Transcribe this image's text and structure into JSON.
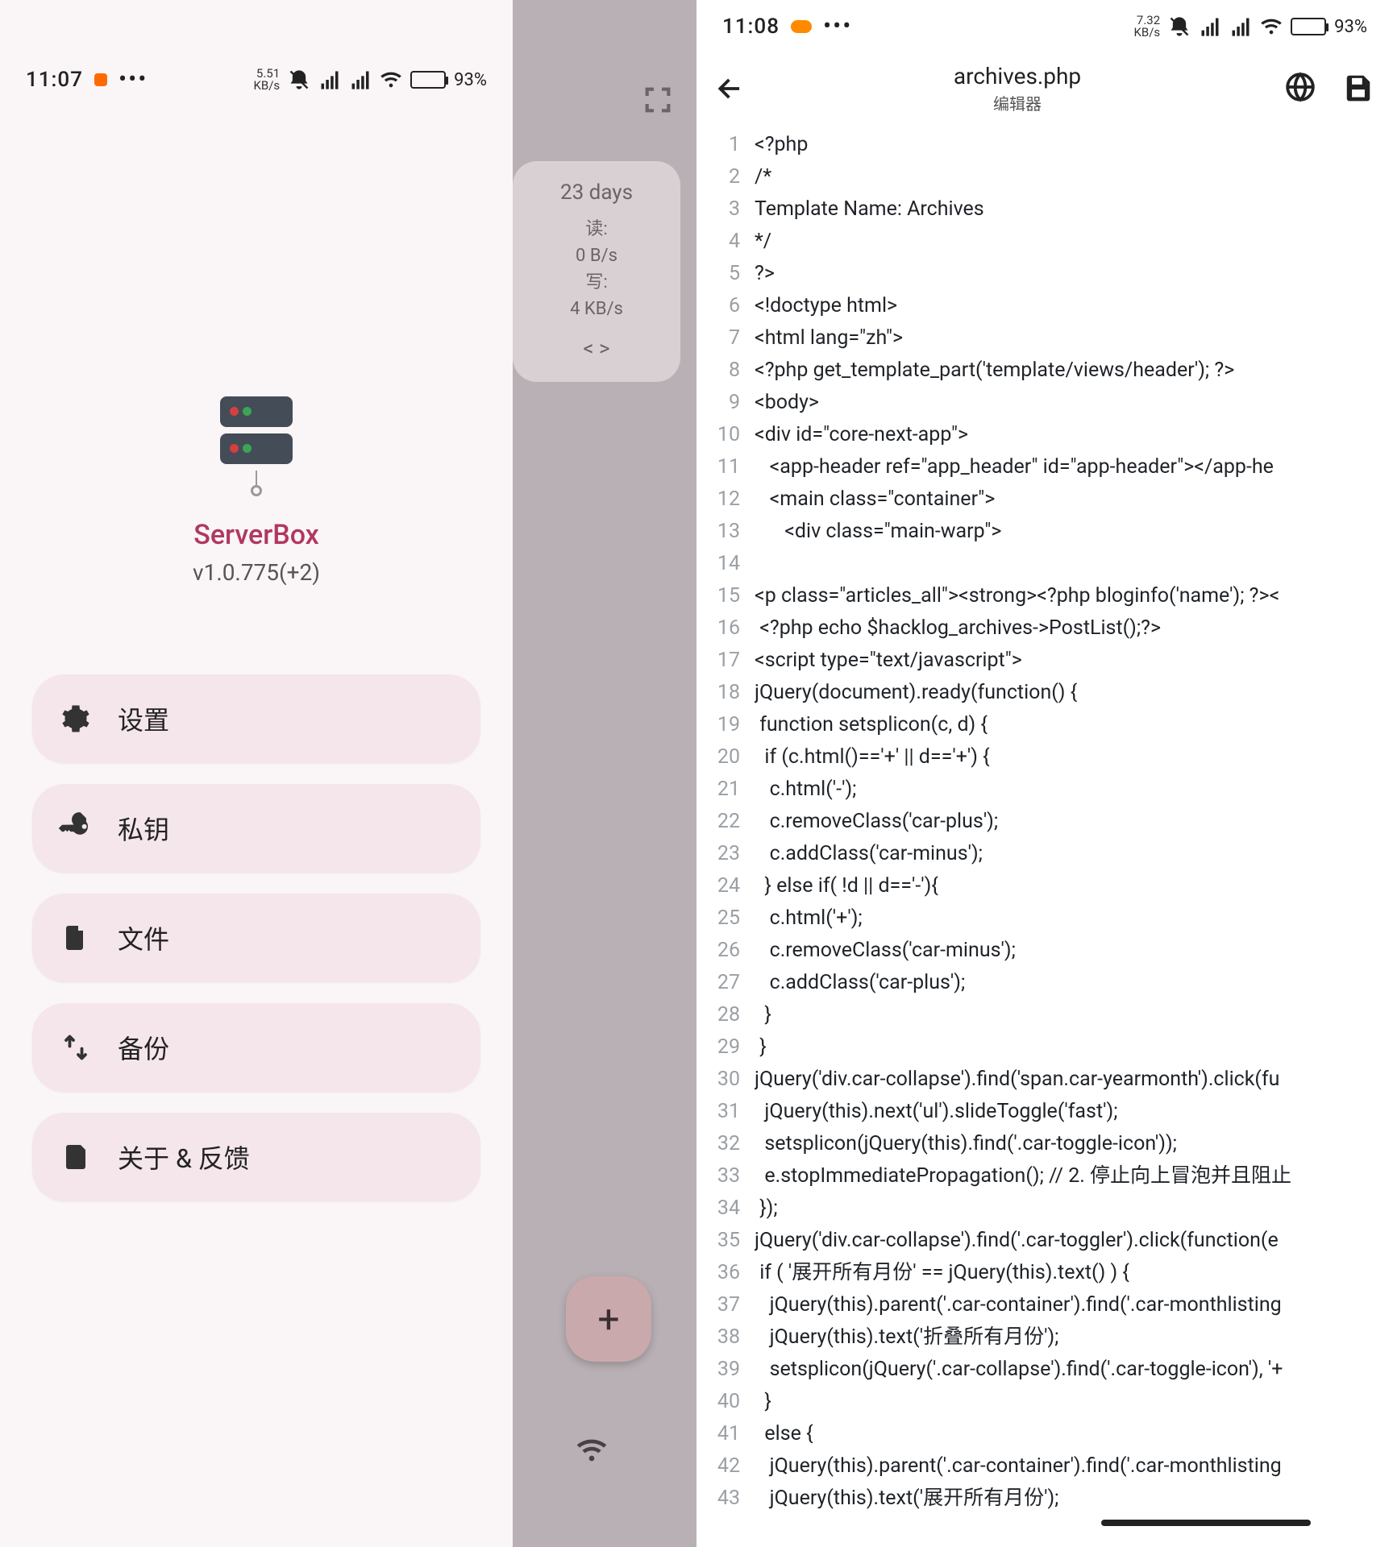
{
  "left": {
    "status": {
      "clock": "11:07",
      "speed_val": "5.51",
      "speed_unit": "KB/s",
      "battery_pct": "93%"
    },
    "brand": {
      "name": "ServerBox",
      "version": "v1.0.775(+2)"
    },
    "menu": {
      "settings": "设置",
      "keys": "私钥",
      "files": "文件",
      "backup": "备份",
      "about": "关于 & 反馈"
    },
    "card": {
      "days": "23 days",
      "read_lbl": "读:",
      "read_val": "0 B/s",
      "write_lbl": "写:",
      "write_val": "4 KB/s",
      "code_arrow": "< >"
    },
    "fab": "+"
  },
  "right": {
    "status": {
      "clock": "11:08",
      "speed_val": "7.32",
      "speed_unit": "KB/s",
      "battery_pct": "93%"
    },
    "title": {
      "filename": "archives.php",
      "subtitle": "编辑器"
    },
    "code": [
      "<?php",
      "/*",
      "Template Name: Archives",
      "*/",
      "?>",
      "<!doctype html>",
      "<html lang=\"zh\">",
      "<?php get_template_part('template/views/header'); ?>",
      "<body>",
      "<div id=\"core-next-app\">",
      "   <app-header ref=\"app_header\" id=\"app-header\"></app-he",
      "   <main class=\"container\">",
      "      <div class=\"main-warp\">",
      "",
      "<p class=\"articles_all\"><strong><?php bloginfo('name'); ?><",
      " <?php echo $hacklog_archives->PostList();?>",
      "<script type=\"text/javascript\">",
      "jQuery(document).ready(function() {",
      " function setsplicon(c, d) {",
      "  if (c.html()=='+' || d=='+') {",
      "   c.html('-');",
      "   c.removeClass('car-plus');",
      "   c.addClass('car-minus');",
      "  } else if( !d || d=='-'){",
      "   c.html('+');",
      "   c.removeClass('car-minus');",
      "   c.addClass('car-plus');",
      "  }",
      " }",
      "jQuery('div.car-collapse').find('span.car-yearmonth').click(fu",
      "  jQuery(this).next('ul').slideToggle('fast');",
      "  setsplicon(jQuery(this).find('.car-toggle-icon'));",
      "  e.stopImmediatePropagation(); // 2. 停止向上冒泡并且阻止",
      " });",
      "jQuery('div.car-collapse').find('.car-toggler').click(function(e",
      " if ( '展开所有月份' == jQuery(this).text() ) {",
      "   jQuery(this).parent('.car-container').find('.car-monthlisting",
      "   jQuery(this).text('折叠所有月份');",
      "   setsplicon(jQuery('.car-collapse').find('.car-toggle-icon'), '+",
      "  }",
      "  else {",
      "   jQuery(this).parent('.car-container').find('.car-monthlisting",
      "   jQuery(this).text('展开所有月份');"
    ]
  }
}
